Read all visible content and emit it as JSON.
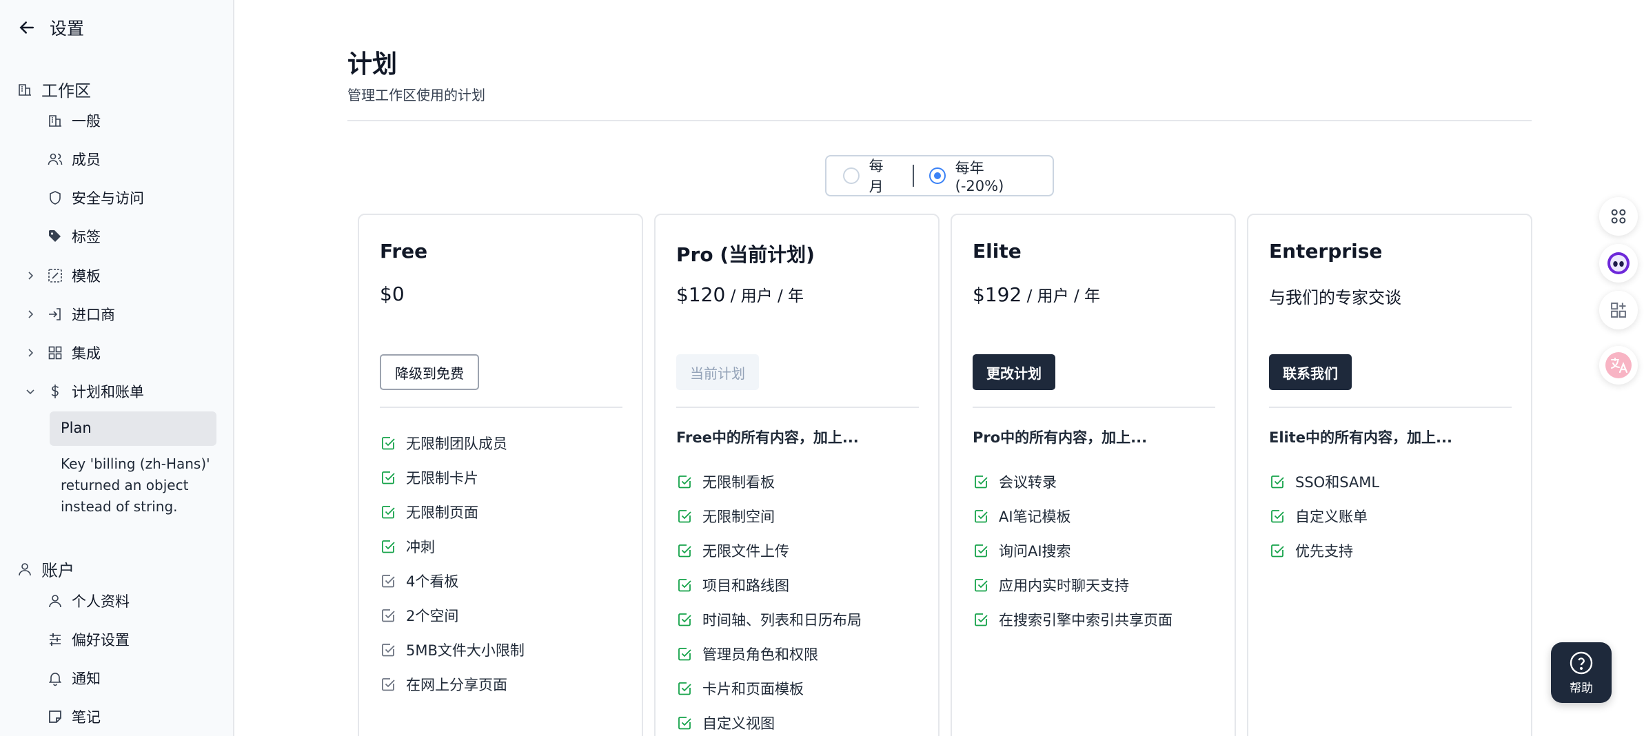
{
  "sidebar": {
    "back_label": "设置",
    "workspace": {
      "label": "工作区",
      "items": [
        {
          "label": "一般"
        },
        {
          "label": "成员"
        },
        {
          "label": "安全与访问"
        },
        {
          "label": "标签"
        },
        {
          "label": "模板"
        },
        {
          "label": "进口商"
        },
        {
          "label": "集成"
        },
        {
          "label": "计划和账单"
        }
      ],
      "billing_sub": {
        "active": "Plan",
        "note": "Key 'billing (zh-Hans)' returned an object instead of string."
      }
    },
    "account": {
      "label": "账户",
      "items": [
        {
          "label": "个人资料"
        },
        {
          "label": "偏好设置"
        },
        {
          "label": "通知"
        },
        {
          "label": "笔记"
        }
      ]
    }
  },
  "main": {
    "title": "计划",
    "subtitle": "管理工作区使用的计划",
    "billing_toggle": {
      "monthly": "每月",
      "yearly": "每年 (-20%)",
      "selected": "yearly"
    },
    "plans": [
      {
        "name": "Free",
        "price": "$0",
        "unit": "",
        "button": "降级到免费",
        "intro": "",
        "features": [
          {
            "text": "无限制团队成员",
            "included": true
          },
          {
            "text": "无限制卡片",
            "included": true
          },
          {
            "text": "无限制页面",
            "included": true
          },
          {
            "text": "冲刺",
            "included": true
          },
          {
            "text": "4个看板",
            "included": false
          },
          {
            "text": "2个空间",
            "included": false
          },
          {
            "text": "5MB文件大小限制",
            "included": false
          },
          {
            "text": "在网上分享页面",
            "included": false
          }
        ]
      },
      {
        "name": "Pro (当前计划)",
        "price": "$120",
        "unit": " / 用户 / 年",
        "button": "当前计划",
        "intro": "Free中的所有内容，加上...",
        "features": [
          {
            "text": "无限制看板",
            "included": true
          },
          {
            "text": "无限制空间",
            "included": true
          },
          {
            "text": "无限文件上传",
            "included": true
          },
          {
            "text": "项目和路线图",
            "included": true
          },
          {
            "text": "时间轴、列表和日历布局",
            "included": true
          },
          {
            "text": "管理员角色和权限",
            "included": true
          },
          {
            "text": "卡片和页面模板",
            "included": true
          },
          {
            "text": "自定义视图",
            "included": true
          }
        ]
      },
      {
        "name": "Elite",
        "price": "$192",
        "unit": " / 用户 / 年",
        "button": "更改计划",
        "intro": "Pro中的所有内容，加上...",
        "features": [
          {
            "text": "会议转录",
            "included": true
          },
          {
            "text": "AI笔记模板",
            "included": true
          },
          {
            "text": "询问AI搜索",
            "included": true
          },
          {
            "text": "应用内实时聊天支持",
            "included": true
          },
          {
            "text": "在搜索引擎中索引共享页面",
            "included": true
          }
        ]
      },
      {
        "name": "Enterprise",
        "price": "与我们的专家交谈",
        "unit": "",
        "button": "联系我们",
        "intro": "Elite中的所有内容，加上...",
        "features": [
          {
            "text": "SSO和SAML",
            "included": true
          },
          {
            "text": "自定义账单",
            "included": true
          },
          {
            "text": "优先支持",
            "included": true
          }
        ]
      }
    ]
  },
  "floating": {
    "help_label": "帮助",
    "icons": [
      "shortcuts-icon",
      "assistant-icon",
      "apps-icon",
      "translate-icon"
    ]
  },
  "colors": {
    "accent_dark": "#1e293b",
    "check_green": "#16a34a",
    "radio_blue": "#3b82f6"
  }
}
